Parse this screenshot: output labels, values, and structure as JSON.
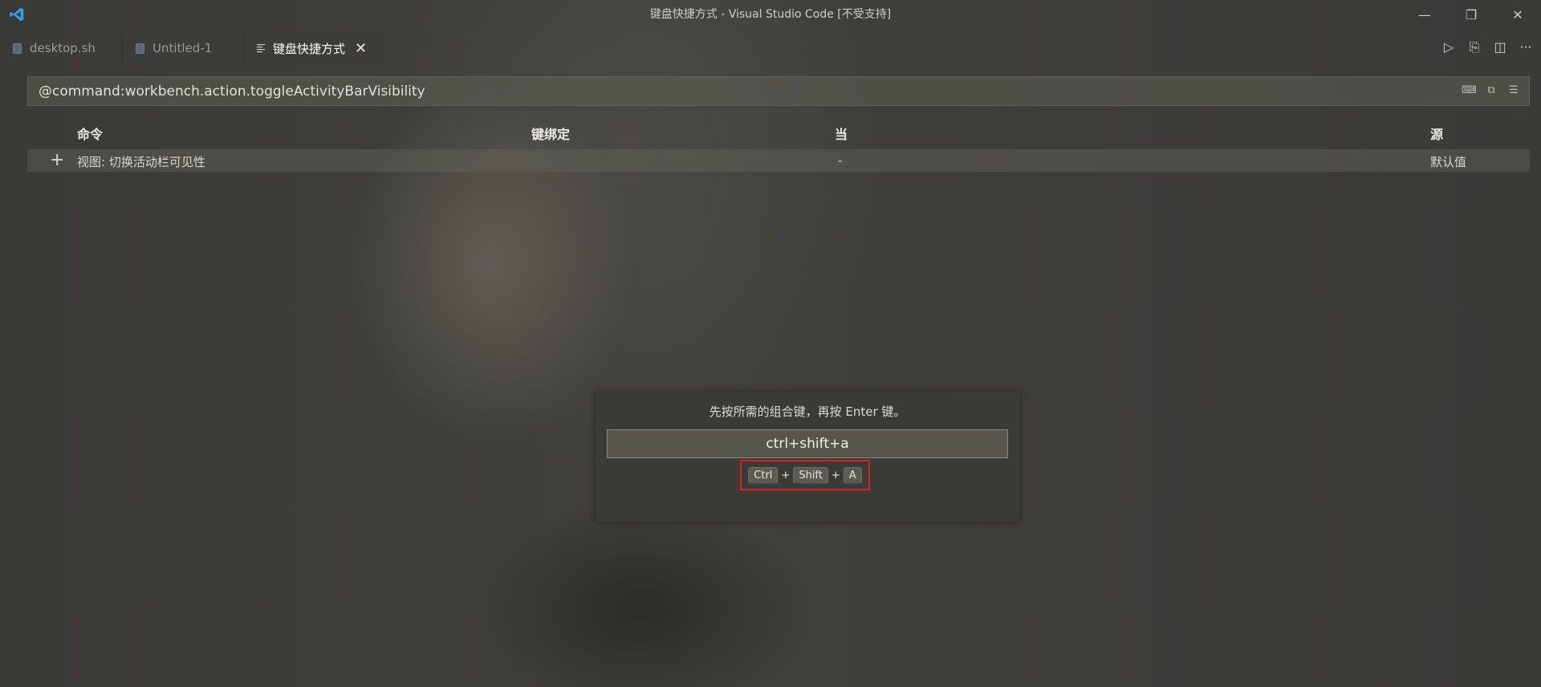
{
  "window": {
    "title": "键盘快捷方式 - Visual Studio Code [不受支持]",
    "controls": {
      "minimize": "—",
      "restore": "❐",
      "close": "✕"
    }
  },
  "tabs": [
    {
      "label": "desktop.sh",
      "icon": "file-icon",
      "active": false
    },
    {
      "label": "Untitled-1",
      "icon": "file-icon",
      "active": false
    },
    {
      "label": "键盘快捷方式",
      "icon": "lines-icon",
      "active": true,
      "close": "✕"
    }
  ],
  "editor_actions": {
    "run": "▷",
    "open_changes": "⎘",
    "split": "◫",
    "more": "···"
  },
  "search": {
    "value": "@command:workbench.action.toggleActivityBarVisibility",
    "icons": [
      "keyboard-icon",
      "record-keys-icon",
      "sort-icon"
    ]
  },
  "table": {
    "headers": {
      "command": "命令",
      "keybinding": "键绑定",
      "when": "当",
      "source": "源"
    },
    "rows": [
      {
        "add": "+",
        "command": "视图: 切换活动栏可见性",
        "keybinding": "",
        "when": "-",
        "source": "默认值"
      }
    ]
  },
  "keybinding_widget": {
    "message": "先按所需的组合键，再按 Enter 键。",
    "input_value": "ctrl+shift+a",
    "keys": [
      "Ctrl",
      "Shift",
      "A"
    ],
    "separator": "+",
    "highlight_color": "#e02020"
  },
  "colors": {
    "accent_logo": "#3b9be8",
    "active_tab_text": "#ffffff"
  }
}
